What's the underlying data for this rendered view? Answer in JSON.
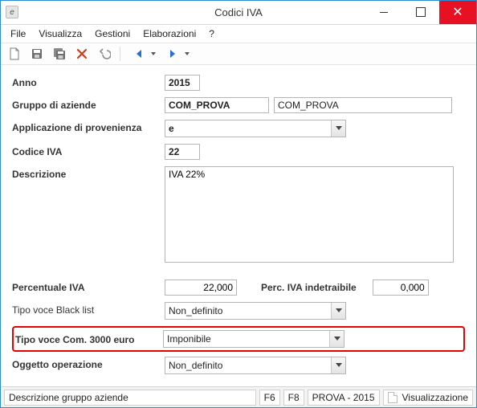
{
  "window": {
    "title": "Codici IVA"
  },
  "menu": {
    "file": "File",
    "visualizza": "Visualizza",
    "gestioni": "Gestioni",
    "elaborazioni": "Elaborazioni",
    "help": "?"
  },
  "form": {
    "anno_label": "Anno",
    "anno_value": "2015",
    "gruppo_label": "Gruppo di aziende",
    "gruppo_code": "COM_PROVA",
    "gruppo_desc": "COM_PROVA",
    "applicazione_label": "Applicazione di provenienza",
    "applicazione_value": "e",
    "codice_label": "Codice IVA",
    "codice_value": "22",
    "descrizione_label": "Descrizione",
    "descrizione_value": "IVA 22%",
    "percentuale_label": "Percentuale IVA",
    "percentuale_value": "22,000",
    "perc_indetr_label": "Perc. IVA indetraibile",
    "perc_indetr_value": "0,000",
    "tipo_black_label": "Tipo voce Black list",
    "tipo_black_value": "Non_definito",
    "tipo_com3000_label": "Tipo voce Com. 3000 euro",
    "tipo_com3000_value": "Imponibile",
    "oggetto_label": "Oggetto operazione",
    "oggetto_value": "Non_definito"
  },
  "status": {
    "desc": "Descrizione gruppo aziende",
    "f6": "F6",
    "f8": "F8",
    "context": "PROVA - 2015",
    "mode": "Visualizzazione"
  }
}
